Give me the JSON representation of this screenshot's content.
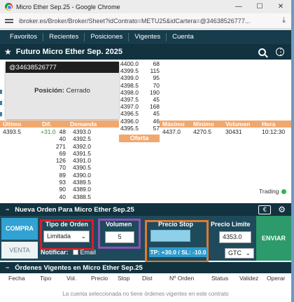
{
  "window": {
    "title": "Micro Ether Sep.25 - Google Chrome"
  },
  "address": {
    "url": "ibroker.es/Broker/Broker/Sheet?idContrato=METU25&idCartera=@34638526777..."
  },
  "nav": {
    "tabs": [
      "Favoritos",
      "Recientes",
      "Posiciones",
      "Vigentes",
      "Cuenta"
    ]
  },
  "instrument": {
    "name": "Futuro Micro Ether Sep. 2025"
  },
  "popover": {
    "account": "@34638526777",
    "position_label": "Posición:",
    "position_value": "Cerrado"
  },
  "offers": [
    {
      "price": "4400.0",
      "qty": "68"
    },
    {
      "price": "4399.5",
      "qty": "115"
    },
    {
      "price": "4399.0",
      "qty": "95"
    },
    {
      "price": "4398.5",
      "qty": "70"
    },
    {
      "price": "4398.0",
      "qty": "190"
    },
    {
      "price": "4397.5",
      "qty": "45"
    },
    {
      "price": "4397.0",
      "qty": "168"
    },
    {
      "price": "4396.5",
      "qty": "45"
    },
    {
      "price": "4396.0",
      "qty": "46"
    },
    {
      "price": "4395.5",
      "qty": "57"
    }
  ],
  "offer_label": "Oferta",
  "quote": {
    "headers": [
      "Último",
      "Dif.",
      "Demanda"
    ],
    "ultimo": "4393.5",
    "dif": "+31.0",
    "right_headers": [
      "Máximo",
      "Mínimo",
      "Volumen",
      "Hora"
    ],
    "maximo": "4437.0",
    "minimo": "4270.5",
    "volumen": "30431",
    "hora": "10:12:30"
  },
  "bids": [
    {
      "qty": "48",
      "price": "4393.0"
    },
    {
      "qty": "40",
      "price": "4392.5"
    },
    {
      "qty": "271",
      "price": "4392.0"
    },
    {
      "qty": "69",
      "price": "4391.5"
    },
    {
      "qty": "126",
      "price": "4391.0"
    },
    {
      "qty": "70",
      "price": "4390.5"
    },
    {
      "qty": "89",
      "price": "4390.0"
    },
    {
      "qty": "93",
      "price": "4389.5"
    },
    {
      "qty": "90",
      "price": "4389.0"
    },
    {
      "qty": "40",
      "price": "4388.5"
    }
  ],
  "trading_label": "Trading",
  "new_order": {
    "title": "Nueva Orden Para Micro Ether Sep.25",
    "buy": "COMPRA",
    "sell": "VENTA",
    "order_type_label": "Tipo de Orden",
    "order_type_value": "Limitada",
    "volume_label": "Volumen",
    "volume_value": "5",
    "stop_label": "Precio Stop",
    "stop_value": "",
    "limit_label": "Precio Limite",
    "limit_value": "4353.0",
    "tpsl": "TP: +30.0 / SL: -10.0",
    "notify_label": "Notificar:",
    "email_label": "Email",
    "validity_value": "GTC",
    "send": "ENVIAR",
    "euro_icon": "€"
  },
  "vigentes": {
    "title": "Órdenes Vigentes en Micro Ether Sep.25",
    "columns": [
      "Fecha",
      "Tipo",
      "Vol.",
      "Precio",
      "Stop",
      "Dist",
      "Nº Orden",
      "Status",
      "Validez",
      "Operar"
    ],
    "empty": "La cuenta seleccionada no tiene órdenes vigentes en este contrato"
  }
}
